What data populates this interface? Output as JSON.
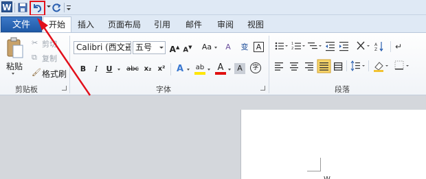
{
  "quick_access": {
    "app_icon_letter": "W"
  },
  "tabs": {
    "file": "文件",
    "items": [
      "开始",
      "插入",
      "页面布局",
      "引用",
      "邮件",
      "审阅",
      "视图"
    ]
  },
  "clipboard": {
    "paste": "粘贴",
    "cut": "剪切",
    "copy": "复制",
    "format_painter": "格式刷",
    "group_label": "剪贴板"
  },
  "font": {
    "font_name": "Calibri (西文正",
    "font_size": "五号",
    "grow": "A",
    "shrink": "A",
    "change_case": "Aa",
    "clear_format": "A",
    "phonetic": "变",
    "border_char": "A",
    "bold": "B",
    "italic": "I",
    "underline": "U",
    "strike": "abc",
    "subscript": "x₂",
    "superscript": "x²",
    "text_effect": "A",
    "highlight": "ab",
    "font_color": "A",
    "char_shading": "A",
    "enclose": "字",
    "group_label": "字体"
  },
  "paragraph": {
    "group_label": "段落"
  },
  "document": {
    "visible_text": "W"
  },
  "colors": {
    "accent_blue": "#2b5797",
    "annotation_red": "#e2101b",
    "highlight_yellow": "#ffe600",
    "font_red": "#e01010"
  }
}
